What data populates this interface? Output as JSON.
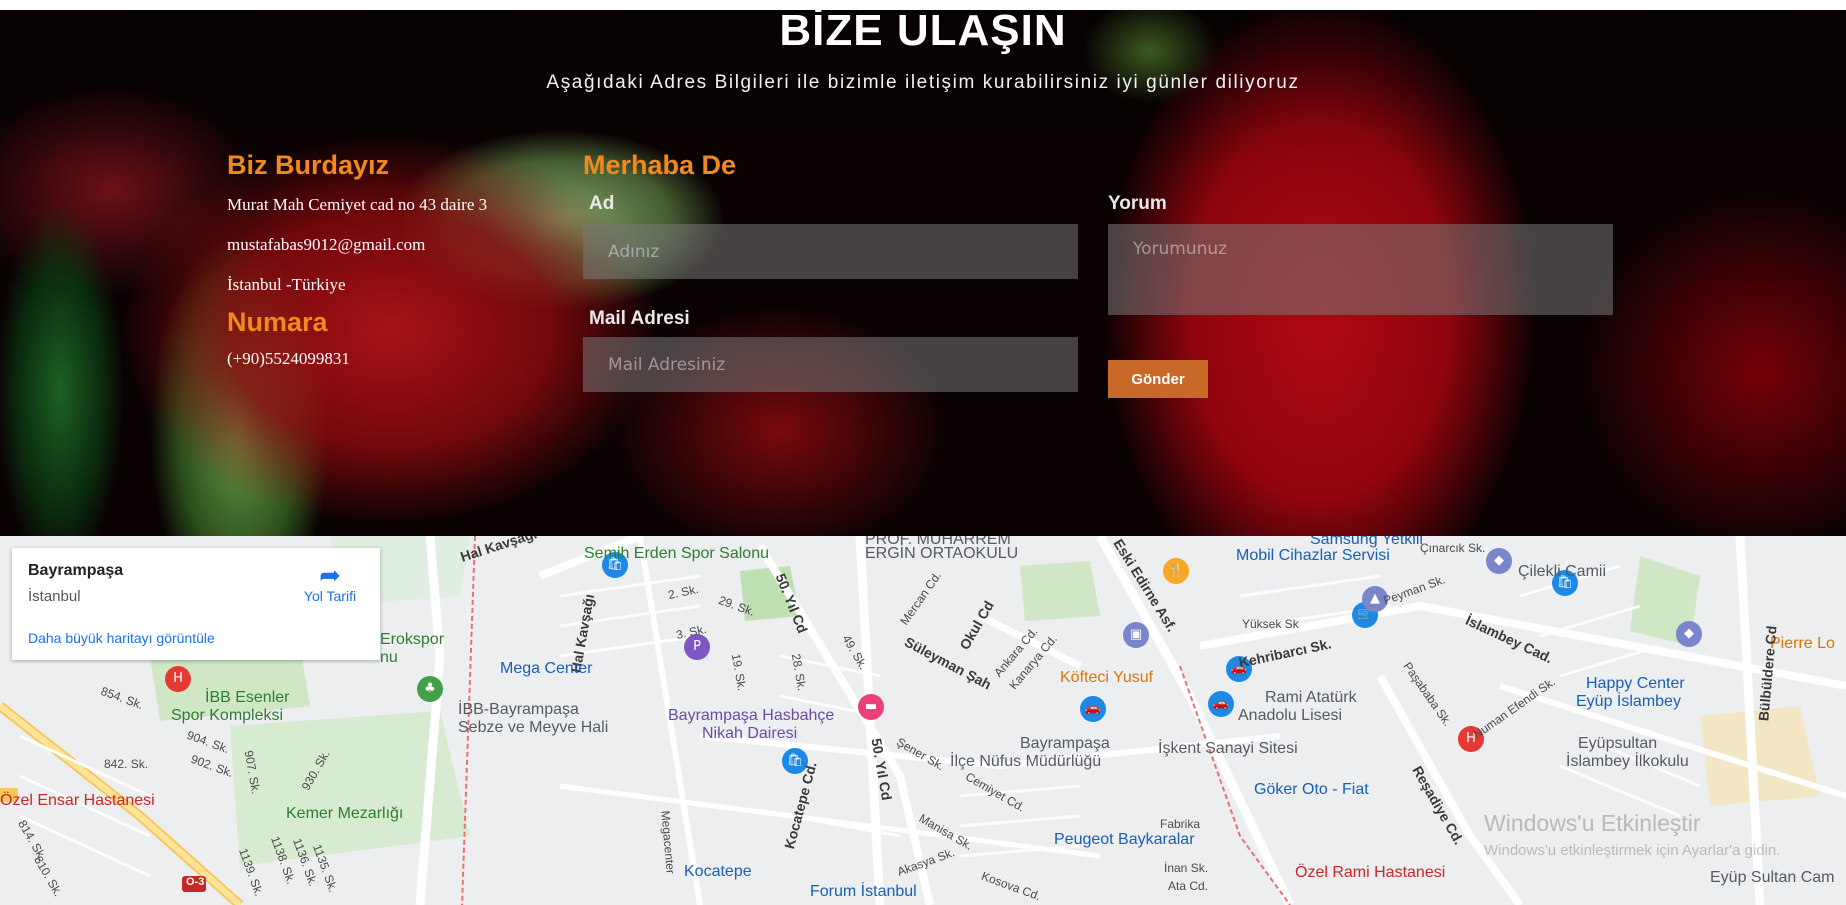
{
  "hero": {
    "title": "BİZE ULAŞIN",
    "subtitle": "Aşağıdaki Adres Bilgileri ile bizimle iletişim kurabilirsiniz iyi günler diliyoruz"
  },
  "contact": {
    "heading": "Biz Burdayız",
    "address": "Murat Mah Cemiyet cad no 43 daire 3",
    "email": "mustafabas9012@gmail.com",
    "city": "İstanbul -Türkiye",
    "phone_heading": "Numara",
    "phone": "(+90)5524099831"
  },
  "form": {
    "heading": "Merhaba De",
    "name_label": "Ad",
    "name_placeholder": "Adınız",
    "mail_label": "Mail Adresi",
    "mail_placeholder": "Mail Adresiniz",
    "comment_label": "Yorum",
    "comment_placeholder": "Yorumunuz",
    "submit_label": "Gönder"
  },
  "map": {
    "card": {
      "title": "Bayrampaşa",
      "subtitle": "İstanbul",
      "directions_label": "Yol Tarifi",
      "larger_map_link": "Daha büyük haritayı görüntüle"
    },
    "labels": {
      "semih_erden": "Semih Erden Spor Salonu",
      "prof_muharrem_1": "PROF. MUHARREM",
      "prof_muharrem_2": "ERGİN ORTAOKULU",
      "samsung_1": "Samsung Yetkili",
      "samsung_2": "Mobil Cihazlar Servisi",
      "cilekli": "Çilekli Camii",
      "pierre": "Pierre Lo",
      "hal_kavsagi": "Hal Kavşağı",
      "hal_kavsagi_v": "Hal Kavşağı",
      "erokspor_1": "Erokspor",
      "erokspor_2": "nu",
      "mega_center": "Mega Center",
      "ibb_esenler_1": "İBB Esenler",
      "ibb_esenler_2": "Spor Kompleksi",
      "ibb_bayrampasa_1": "İBB-Bayrampaşa",
      "ibb_bayrampasa_2": "Sebze ve Meyve Hali",
      "hasbahce_1": "Bayrampaşa Hasbahçe",
      "hasbahce_2": "Nikah Dairesi",
      "kofteci": "Köfteci Yusuf",
      "rami_1": "Rami Atatürk",
      "rami_2": "Anadolu Lisesi",
      "happy_1": "Happy Center",
      "happy_2": "Eyüp İslambey",
      "eyupsultan_1": "Eyüpsultan",
      "eyupsultan_2": "İslambey İlkokulu",
      "nufus_1": "Bayrampaşa",
      "nufus_2": "İlçe Nüfus Müdürlüğü",
      "iskent": "İşkent Sanayi Sitesi",
      "goker": "Göker Oto - Fiat",
      "ozel_ensar": "Özel Ensar Hastanesi",
      "kemer": "Kemer Mezarlığı",
      "peugeot": "Peugeot Baykaralar",
      "ozel_rami": "Özel Rami Hastanesi",
      "eyup_sultan_cam": "Eyüp Sultan Cam",
      "kocatepe": "Kocatepe",
      "forum": "Forum İstanbul",
      "fabrika": "Fabrika",
      "yil_cd_1": "50. Yıl Cd",
      "yil_cd_2": "50. Yıl Cd",
      "okul_cd": "Okul Cd",
      "suleyman": "Süleyman Şah",
      "eski_edirne": "Eski Edirne Asf.",
      "kehribarci": "Kehribarcı Sk.",
      "islambey_cad": "İslambey Cad.",
      "resadiye": "Reşadiye Cd.",
      "kocatepe_cd": "Kocatepe Cd.",
      "bulbuldere": "Bülbüldere Cd",
      "yuksek": "Yüksek Sk",
      "cinarcik": "Çınarcık Sk.",
      "peyman": "Peyman Sk.",
      "sk2": "2. Sk.",
      "sk29": "29. Sk.",
      "sk3": "3. Sk.",
      "sk19": "19. Sk.",
      "sk28": "28. Sk.",
      "sk49": "49. Sk.",
      "mercan": "Mercan Cd.",
      "ankara": "Ankara Cd.",
      "kanarya": "Kanarya Cd.",
      "sk854": "854. Sk.",
      "sk904": "904. Sk.",
      "sk902": "902. Sk.",
      "sk842": "842. Sk.",
      "sk907": "907. Sk.",
      "sk930": "930. Sk.",
      "senersk": "Şener Sk.",
      "cemiyet": "Cemiyet Cd.",
      "manisa": "Manisa Sk.",
      "akasya": "Akasya Sk.",
      "inan": "İnan Sk.",
      "ata": "Ata Cd.",
      "kosova": "Kosova Cd.",
      "megacenter_road": "Megacenter",
      "pasababa": "Paşababa Sk.",
      "numan": "Numan Efendi Sk.",
      "sk814": "814. Sk.",
      "sk810": "810. Sk.",
      "sk1138": "1138. Sk.",
      "sk1136": "1136. Sk.",
      "sk1139": "1139. Sk.",
      "sk1135": "1135. Sk.",
      "shield_03": "O-3"
    }
  },
  "watermark": {
    "line1": "Windows'u Etkinleştir",
    "line2": "Windows'u etkinleştirmek için Ayarlar'a gidin."
  }
}
